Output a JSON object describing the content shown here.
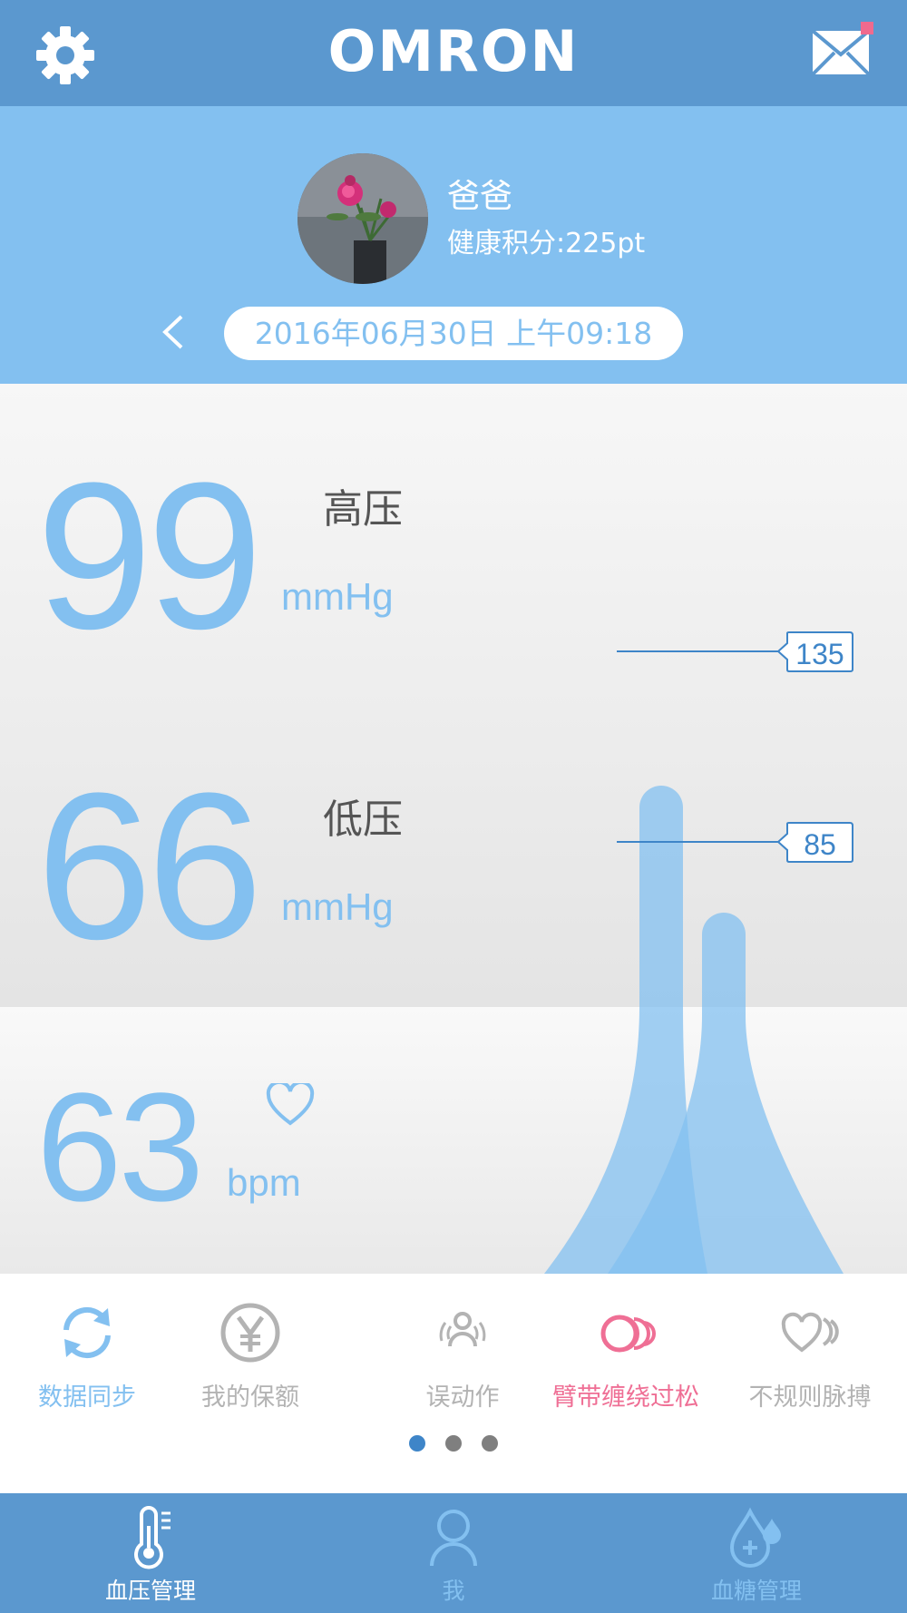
{
  "header": {
    "logo_text": "OMRON",
    "settings_icon": "gear-icon",
    "mail_icon": "envelope-icon",
    "mail_badge_color": "#f06a8e"
  },
  "profile": {
    "name": "爸爸",
    "points": "健康积分:225pt",
    "datetime": "2016年06月30日 上午09:18"
  },
  "readings": {
    "systolic": {
      "value": "99",
      "label": "高压",
      "unit": "mmHg"
    },
    "diastolic": {
      "value": "66",
      "label": "低压",
      "unit": "mmHg"
    },
    "pulse": {
      "value": "63",
      "unit": "bpm"
    }
  },
  "gauge": {
    "systolic_threshold": "135",
    "diastolic_threshold": "85",
    "systolic_value": 99,
    "diastolic_value": 66,
    "accent": "#83c0f0"
  },
  "features": [
    {
      "label": "数据同步",
      "icon": "sync-icon",
      "color": "#83c0f0"
    },
    {
      "label": "我的保额",
      "icon": "yen-icon",
      "color": "#b3b3b3"
    },
    {
      "label": "误动作",
      "icon": "movement-icon",
      "color": "#b3b3b3"
    },
    {
      "label": "臂带缠绕过松",
      "icon": "cuff-loose-icon",
      "color": "#ef6f95"
    },
    {
      "label": "不规则脉搏",
      "icon": "irregular-pulse-icon",
      "color": "#b3b3b3"
    }
  ],
  "pager": {
    "pages": 3,
    "active": 1
  },
  "nav": [
    {
      "label": "血压管理",
      "icon": "thermometer-icon",
      "active": true
    },
    {
      "label": "我",
      "icon": "person-icon",
      "active": false
    },
    {
      "label": "血糖管理",
      "icon": "blood-drop-icon",
      "active": false
    }
  ]
}
